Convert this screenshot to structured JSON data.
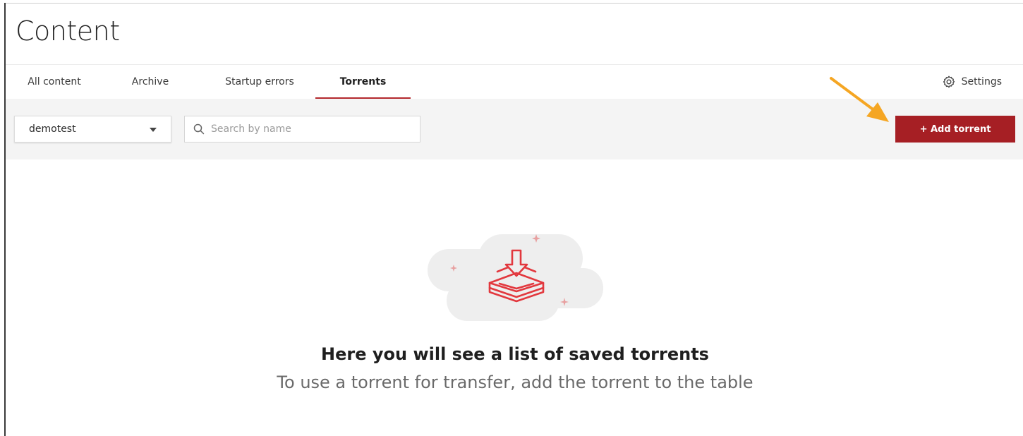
{
  "page": {
    "title": "Content"
  },
  "tabs": [
    {
      "label": "All content",
      "active": false
    },
    {
      "label": "Archive",
      "active": false
    },
    {
      "label": "Startup errors",
      "active": false
    },
    {
      "label": "Torrents",
      "active": true
    }
  ],
  "settings": {
    "label": "Settings",
    "icon": "gear-icon"
  },
  "toolbar": {
    "project_select": {
      "value": "demotest",
      "icon": "caret-down-icon"
    },
    "search": {
      "placeholder": "Search by name",
      "value": "",
      "icon": "search-icon"
    },
    "add_button": {
      "label": "+ Add torrent"
    }
  },
  "empty_state": {
    "icon": "download-tray-icon",
    "title": "Here you will see a list of saved torrents",
    "subtitle": "To use a torrent for transfer, add the torrent to the table"
  },
  "colors": {
    "accent": "#a61f24",
    "tab_underline": "#b3282d",
    "toolbar_bg": "#f4f4f4",
    "annotation_arrow": "#f5a623"
  }
}
